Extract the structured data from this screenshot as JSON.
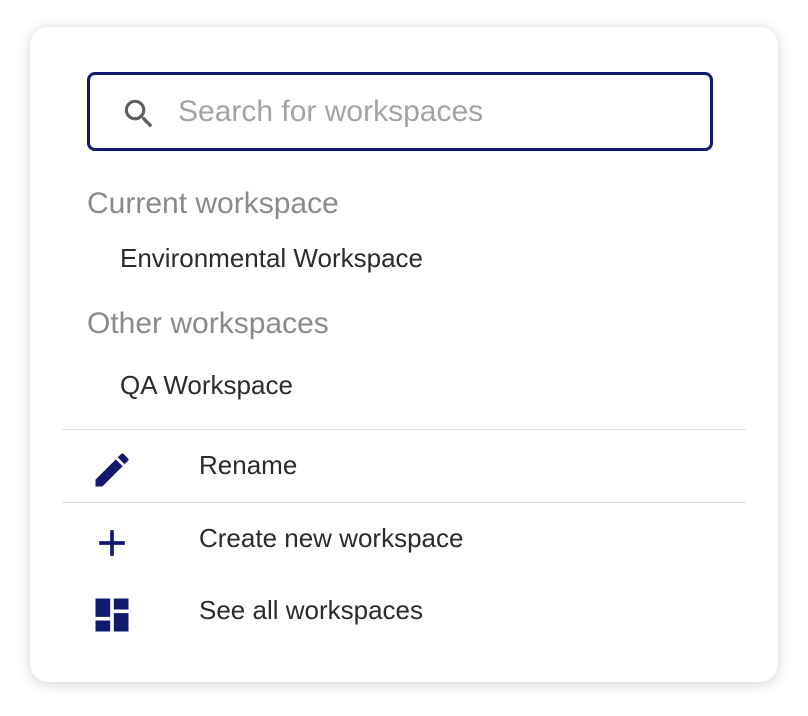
{
  "search": {
    "placeholder": "Search for workspaces",
    "value": "",
    "icon": "search-icon"
  },
  "current": {
    "heading": "Current workspace",
    "item": "Environmental Workspace"
  },
  "others": {
    "heading": "Other workspaces",
    "items": [
      "QA Workspace"
    ]
  },
  "actions": {
    "rename": {
      "label": "Rename",
      "icon": "pencil-icon"
    },
    "create": {
      "label": "Create new workspace",
      "icon": "plus-icon"
    },
    "see_all": {
      "label": "See all workspaces",
      "icon": "dashboard-icon"
    }
  },
  "colors": {
    "accent": "#111a6e",
    "heading": "#8a8a8a",
    "text": "#2b2b2b",
    "divider": "#dedede"
  }
}
